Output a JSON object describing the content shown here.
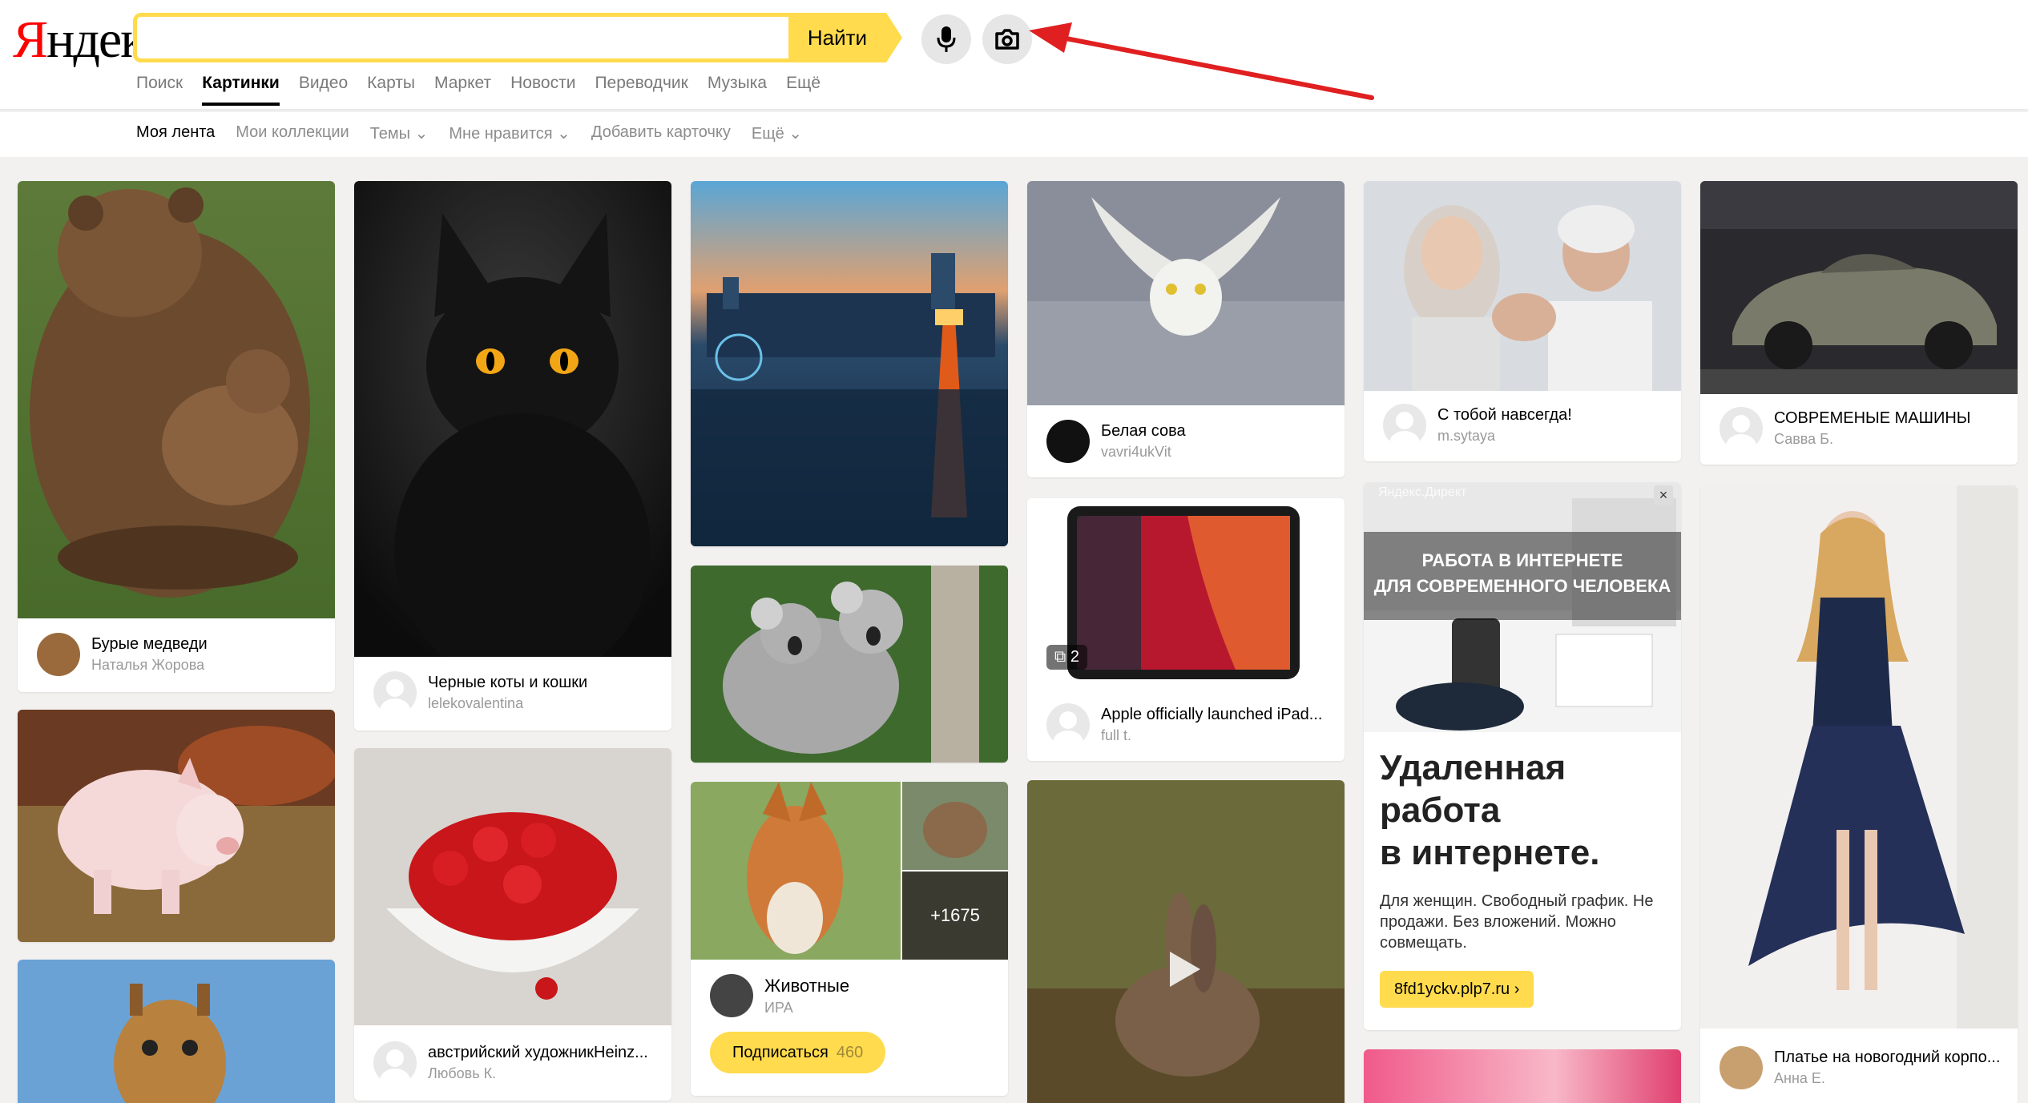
{
  "header": {
    "logo_first": "Я",
    "logo_rest": "ндекс",
    "search_value": "",
    "search_button": "Найти",
    "mic_icon": "microphone-icon",
    "camera_icon": "camera-icon"
  },
  "services": [
    "Поиск",
    "Картинки",
    "Видео",
    "Карты",
    "Маркет",
    "Новости",
    "Переводчик",
    "Музыка",
    "Ещё"
  ],
  "services_active": "Картинки",
  "subnav": {
    "my_feed": "Моя лента",
    "my_collections": "Мои коллекции",
    "themes": "Темы ⌄",
    "liked": "Мне нравится ⌄",
    "add_card": "Добавить карточку",
    "more": "Ещё ⌄"
  },
  "cards": {
    "bears": {
      "title": "Бурые медведи",
      "author": "Наталья Жорова"
    },
    "cats": {
      "title": "Черные коты и кошки",
      "author": "lelekovalentina"
    },
    "painting": {
      "title": "австрийский художникHeinz...",
      "author": "Любовь К."
    },
    "animals": {
      "title": "Животные",
      "author": "ИРА",
      "more_count": "+1675",
      "subscribe": "Подписаться",
      "subscribers": "460"
    },
    "owl": {
      "title": "Белая сова",
      "author": "vavri4ukVit"
    },
    "ipad": {
      "title": "Apple officially launched iPad...",
      "author": "full t.",
      "count": "2"
    },
    "couple": {
      "title": "С тобой навсегда!",
      "author": "m.sytaya"
    },
    "cars": {
      "title": "СОВРЕМЕНЫЕ МАШИНЫ",
      "author": "Савва Б."
    },
    "dress": {
      "title": "Платье на новогодний корпо...",
      "author": "Анна Е."
    }
  },
  "ad": {
    "label": "Яндекс.Директ",
    "banner_line1": "РАБОТА В ИНТЕРНЕТЕ",
    "banner_line2": "ДЛЯ СОВРЕМЕННОГО ЧЕЛОВЕКА",
    "title_line1": "Удаленная",
    "title_line2": "работа",
    "title_line3": "в интернете.",
    "text": "Для женщин. Свободный график. Не продажи. Без вложений. Можно совмещать.",
    "link": "8fd1yckv.plp7.ru ›",
    "close": "×"
  },
  "colors": {
    "accent": "#ffdb4d",
    "logo_red": "#ff0000",
    "arrow": "#e02020",
    "background": "#f2f1ef"
  }
}
